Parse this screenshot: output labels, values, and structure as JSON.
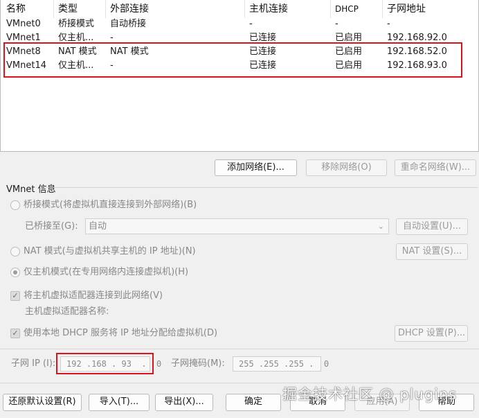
{
  "table": {
    "headers": [
      "名称",
      "类型",
      "外部连接",
      "主机连接",
      "DHCP",
      "子网地址"
    ],
    "rows": [
      [
        "VMnet0",
        "桥接模式",
        "自动桥接",
        "-",
        "-",
        "-"
      ],
      [
        "VMnet1",
        "仅主机...",
        "-",
        "已连接",
        "已启用",
        "192.168.92.0"
      ],
      [
        "VMnet8",
        "NAT 模式",
        "NAT 模式",
        "已连接",
        "已启用",
        "192.168.52.0"
      ],
      [
        "VMnet14",
        "仅主机...",
        "-",
        "已连接",
        "已启用",
        "192.168.93.0"
      ]
    ]
  },
  "network_buttons": {
    "add": "添加网络(E)...",
    "remove": "移除网络(O)",
    "rename": "重命名网络(W)..."
  },
  "info": {
    "group_title": "VMnet 信息",
    "bridged_option": "桥接模式(将虚拟机直接连接到外部网络)(B)",
    "bridged_to_label": "已桥接至(G):",
    "bridged_to_value": "自动",
    "auto_settings_button": "自动设置(U)...",
    "nat_option": "NAT 模式(与虚拟机共享主机的 IP 地址)(N)",
    "nat_settings_button": "NAT 设置(S)...",
    "hostonly_option": "仅主机模式(在专用网络内连接虚拟机)(H)",
    "connect_adapter_option": "将主机虚拟适配器连接到此网络(V)",
    "adapter_name_label": "主机虚拟适配器名称:",
    "dhcp_option": "使用本地 DHCP 服务将 IP 地址分配给虚拟机(D)",
    "dhcp_settings_button": "DHCP 设置(P)...",
    "subnet_ip_label": "子网 IP (I):",
    "subnet_ip_value": "192 .168 . 93  .  0",
    "subnet_mask_label": "子网掩码(M):",
    "subnet_mask_value": "255 .255 .255 .  0"
  },
  "footer": {
    "restore_defaults": "还原默认设置(R)",
    "import": "导入(T)...",
    "export": "导出(X)...",
    "ok": "确定",
    "cancel": "取消",
    "apply": "应用(A)",
    "help": "帮助"
  },
  "watermark": "掘金技术社区 @ plugins",
  "colors": {
    "highlight": "#d9141b"
  }
}
